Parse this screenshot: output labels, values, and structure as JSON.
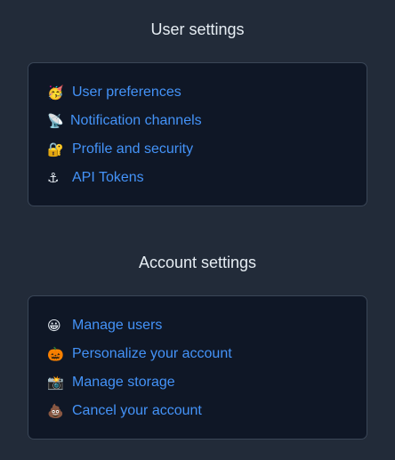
{
  "user_settings": {
    "title": "User settings",
    "items": [
      {
        "emoji": "🥳",
        "label": "User preferences",
        "icon": "party-face-icon"
      },
      {
        "emoji": "📡",
        "label": "Notification channels",
        "icon": "satellite-dish-icon"
      },
      {
        "emoji": "🔐",
        "label": "Profile and security",
        "icon": "lock-with-key-icon"
      },
      {
        "emoji": "⚓",
        "label": "API Tokens",
        "icon": "anchor-icon"
      }
    ]
  },
  "account_settings": {
    "title": "Account settings",
    "items": [
      {
        "emoji": "😀",
        "label": "Manage users",
        "icon": "grinning-face-icon"
      },
      {
        "emoji": "🎃",
        "label": "Personalize your account",
        "icon": "jack-o-lantern-icon"
      },
      {
        "emoji": "📸",
        "label": "Manage storage",
        "icon": "camera-icon"
      },
      {
        "emoji": "💩",
        "label": "Cancel your account",
        "icon": "pile-of-poo-icon"
      }
    ]
  },
  "colors": {
    "background": "#222b39",
    "card": "#0f1726",
    "border": "#3a4657",
    "link": "#4493f8",
    "title": "#e6edf3"
  }
}
